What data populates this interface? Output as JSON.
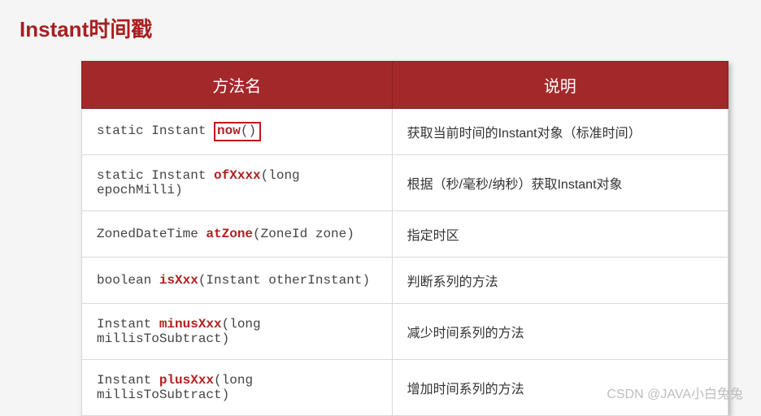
{
  "title": "Instant时间戳",
  "header": {
    "col1": "方法名",
    "col2": "说明"
  },
  "rows": [
    {
      "pre": "static Instant ",
      "kw": "now",
      "boxExtra": "()",
      "post": "",
      "desc": "获取当前时间的Instant对象（标准时间）"
    },
    {
      "pre": "static Instant ",
      "kw": "ofXxxx",
      "post": "(long epochMilli)",
      "desc": "根据（秒/毫秒/纳秒）获取Instant对象"
    },
    {
      "pre": "ZonedDateTime ",
      "kw": "atZone",
      "post": "(ZoneId zone)",
      "desc": "指定时区"
    },
    {
      "pre": "boolean ",
      "kw": "isXxx",
      "post": "(Instant otherInstant)",
      "desc": "判断系列的方法"
    },
    {
      "pre": "Instant ",
      "kw": "minusXxx",
      "post": "(long millisToSubtract)",
      "desc": "减少时间系列的方法"
    },
    {
      "pre": "Instant ",
      "kw": "plusXxx",
      "post": "(long millisToSubtract)",
      "desc": "增加时间系列的方法"
    }
  ],
  "watermark": "CSDN @JAVA小白兔兔"
}
